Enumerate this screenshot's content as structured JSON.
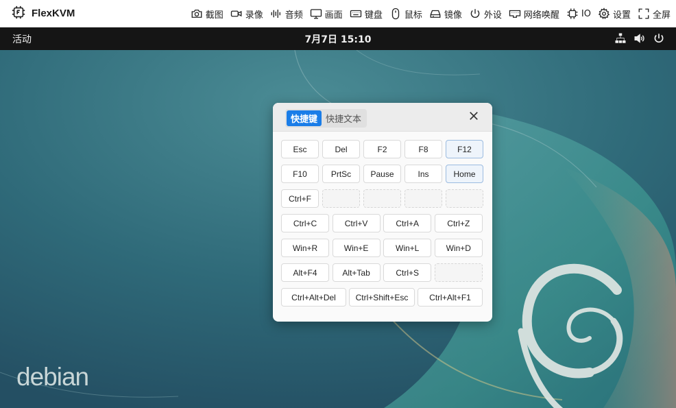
{
  "app": {
    "title": "FlexKVM",
    "toolbar": [
      {
        "icon": "camera-icon",
        "label": "截图"
      },
      {
        "icon": "video-icon",
        "label": "录像"
      },
      {
        "icon": "audio-icon",
        "label": "音频"
      },
      {
        "icon": "monitor-icon",
        "label": "画面"
      },
      {
        "icon": "keyboard-icon",
        "label": "键盘"
      },
      {
        "icon": "mouse-icon",
        "label": "鼠标"
      },
      {
        "icon": "drive-icon",
        "label": "镜像"
      },
      {
        "icon": "power-icon",
        "label": "外设"
      },
      {
        "icon": "network-wake-icon",
        "label": "网络唤醒"
      },
      {
        "icon": "chip-icon",
        "label": "IO"
      },
      {
        "icon": "gear-icon",
        "label": "设置"
      },
      {
        "icon": "fullscreen-icon",
        "label": "全屏"
      }
    ]
  },
  "desktop": {
    "panel": {
      "activities": "活动",
      "clock": "7月7日  15:10"
    },
    "wordmark": "debian"
  },
  "dialog": {
    "tabs": [
      "快捷键",
      "快捷文本"
    ],
    "active_tab": 0,
    "rows": [
      {
        "cols": 5,
        "keys": [
          "Esc",
          "Del",
          "F2",
          "F8",
          "F12"
        ]
      },
      {
        "cols": 5,
        "keys": [
          "F10",
          "PrtSc",
          "Pause",
          "Ins",
          "Home"
        ]
      },
      {
        "cols": 5,
        "keys": [
          "Ctrl+F",
          "",
          "",
          "",
          ""
        ]
      },
      {
        "cols": 4,
        "keys": [
          "Ctrl+C",
          "Ctrl+V",
          "Ctrl+A",
          "Ctrl+Z"
        ]
      },
      {
        "cols": 4,
        "keys": [
          "Win+R",
          "Win+E",
          "Win+L",
          "Win+D"
        ]
      },
      {
        "cols": 4,
        "keys": [
          "Alt+F4",
          "Alt+Tab",
          "Ctrl+S",
          ""
        ]
      },
      {
        "cols": 3,
        "keys": [
          "Ctrl+Alt+Del",
          "Ctrl+Shift+Esc",
          "Ctrl+Alt+F1"
        ]
      }
    ],
    "highlighted": [
      "F12",
      "Home"
    ]
  }
}
